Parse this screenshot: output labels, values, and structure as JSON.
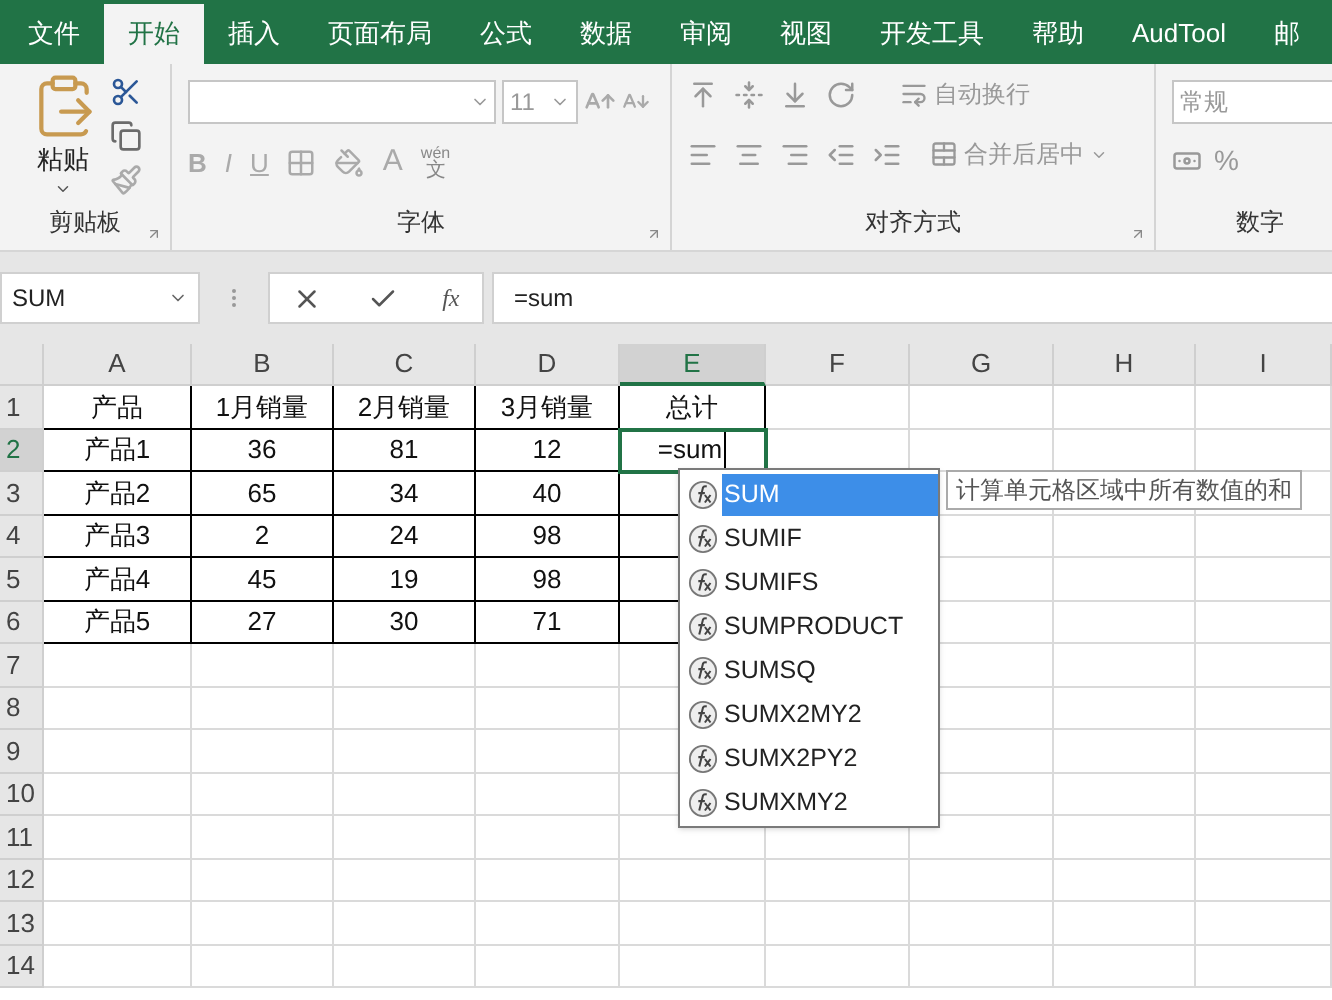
{
  "tabs": [
    {
      "label": "文件",
      "selected": false
    },
    {
      "label": "开始",
      "selected": true
    },
    {
      "label": "插入",
      "selected": false
    },
    {
      "label": "页面布局",
      "selected": false
    },
    {
      "label": "公式",
      "selected": false
    },
    {
      "label": "数据",
      "selected": false
    },
    {
      "label": "审阅",
      "selected": false
    },
    {
      "label": "视图",
      "selected": false
    },
    {
      "label": "开发工具",
      "selected": false
    },
    {
      "label": "帮助",
      "selected": false
    },
    {
      "label": "AudTool",
      "selected": false
    },
    {
      "label": "邮",
      "selected": false
    }
  ],
  "ribbon": {
    "clipboard": {
      "paste": "粘贴",
      "group": "剪贴板"
    },
    "font": {
      "font_size": "11",
      "bold": "B",
      "italic": "I",
      "underline": "U",
      "font_color": "A",
      "phonetic_top": "wén",
      "phonetic_bottom": "文",
      "group": "字体"
    },
    "alignment": {
      "wrap": "自动换行",
      "merge": "合并后居中",
      "group": "对齐方式"
    },
    "number": {
      "format": "常规",
      "percent": "%",
      "group": "数字"
    }
  },
  "formula_bar": {
    "name_box": "SUM",
    "fx": "fx",
    "formula": "=sum"
  },
  "sheet": {
    "columns": [
      {
        "label": "A",
        "selected": false
      },
      {
        "label": "B",
        "selected": false
      },
      {
        "label": "C",
        "selected": false
      },
      {
        "label": "D",
        "selected": false
      },
      {
        "label": "E",
        "selected": true
      },
      {
        "label": "F",
        "selected": false
      },
      {
        "label": "G",
        "selected": false
      },
      {
        "label": "H",
        "selected": false
      },
      {
        "label": "I",
        "selected": false
      }
    ],
    "rows": [
      {
        "header": "1",
        "selected": false,
        "cells": [
          "产品",
          "1月销量",
          "2月销量",
          "3月销量",
          "总计"
        ]
      },
      {
        "header": "2",
        "selected": true,
        "cells": [
          "产品1",
          "36",
          "81",
          "12"
        ]
      },
      {
        "header": "3",
        "selected": false,
        "cells": [
          "产品2",
          "65",
          "34",
          "40"
        ]
      },
      {
        "header": "4",
        "selected": false,
        "cells": [
          "产品3",
          "2",
          "24",
          "98"
        ]
      },
      {
        "header": "5",
        "selected": false,
        "cells": [
          "产品4",
          "45",
          "19",
          "98"
        ]
      },
      {
        "header": "6",
        "selected": false,
        "cells": [
          "产品5",
          "27",
          "30",
          "71"
        ]
      },
      {
        "header": "7",
        "selected": false
      },
      {
        "header": "8",
        "selected": false
      },
      {
        "header": "9",
        "selected": false
      },
      {
        "header": "10",
        "selected": false
      },
      {
        "header": "11",
        "selected": false
      },
      {
        "header": "12",
        "selected": false
      },
      {
        "header": "13",
        "selected": false
      },
      {
        "header": "14",
        "selected": false
      }
    ],
    "editing": "=sum"
  },
  "autocomplete": {
    "items": [
      {
        "label": "SUM",
        "selected": true
      },
      {
        "label": "SUMIF",
        "selected": false
      },
      {
        "label": "SUMIFS",
        "selected": false
      },
      {
        "label": "SUMPRODUCT",
        "selected": false
      },
      {
        "label": "SUMSQ",
        "selected": false
      },
      {
        "label": "SUMX2MY2",
        "selected": false
      },
      {
        "label": "SUMX2PY2",
        "selected": false
      },
      {
        "label": "SUMXMY2",
        "selected": false
      }
    ],
    "tooltip": "计算单元格区域中所有数值的和"
  }
}
